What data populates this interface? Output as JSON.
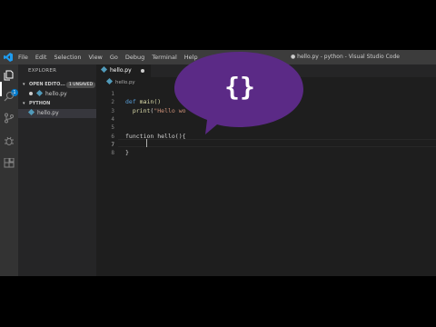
{
  "window": {
    "title": "● hello.py - python - Visual Studio Code"
  },
  "menu": [
    "File",
    "Edit",
    "Selection",
    "View",
    "Go",
    "Debug",
    "Terminal",
    "Help"
  ],
  "activity": {
    "badge": "1",
    "icons": [
      "files-icon",
      "search-icon",
      "source-control-icon",
      "debug-icon",
      "extensions-icon"
    ]
  },
  "sidebar": {
    "title": "EXPLORER",
    "open_editors": {
      "label": "OPEN EDITO...",
      "badge": "1 UNSAVED",
      "file": "hello.py"
    },
    "folder": {
      "label": "PYTHON",
      "file": "hello.py"
    }
  },
  "tab": {
    "label": "hello.py"
  },
  "breadcrumb": "hello.py",
  "editor": {
    "line_numbers": [
      "1",
      "2",
      "3",
      "4",
      "5",
      "6",
      "7",
      "8"
    ],
    "lines": [
      "",
      "def main()",
      "  print(\"Hello wo",
      "",
      "",
      "function hello(){",
      "    ",
      "}"
    ]
  },
  "bubble": {
    "text": "{}"
  },
  "colors": {
    "accent": "#007acc",
    "bubble": "#5b2a86",
    "editor_bg": "#1e1e1e",
    "sidebar_bg": "#252526"
  }
}
